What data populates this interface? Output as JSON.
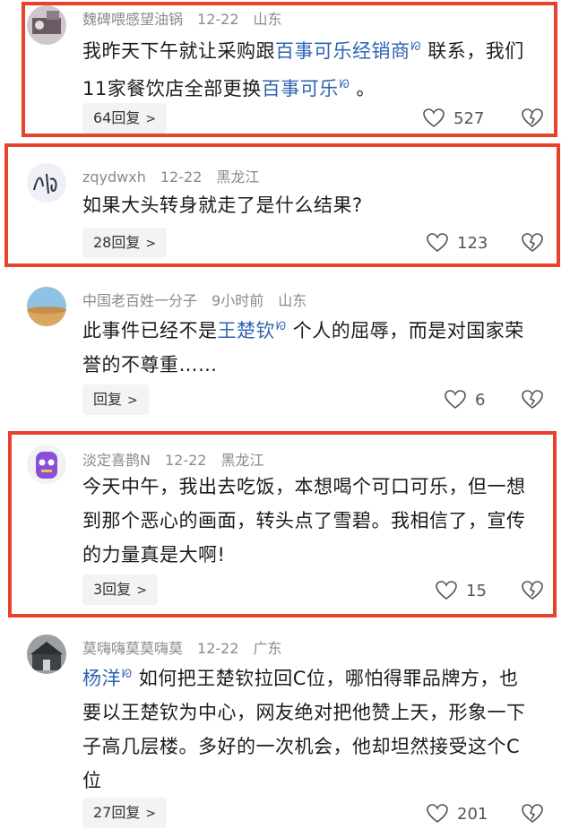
{
  "comments": [
    {
      "user": "魏碑喂感望油锅",
      "date": "12-22",
      "location": "山东",
      "text": [
        {
          "t": "我昨天下午就让采购跟"
        },
        {
          "t": "百事可乐经销商",
          "link": true
        },
        {
          "t": " 联系，我们11家餐饮店全部更换"
        },
        {
          "t": "百事可乐",
          "link": true
        },
        {
          "t": " 。"
        }
      ],
      "reply_label": "64回复",
      "likes": "527",
      "highlighted": true
    },
    {
      "user": "zqydwxh",
      "date": "12-22",
      "location": "黑龙江",
      "text": [
        {
          "t": "如果大头转身就走了是什么结果?"
        }
      ],
      "reply_label": "28回复",
      "likes": "123",
      "highlighted": true
    },
    {
      "user": "中国老百姓一分子",
      "date": "9小时前",
      "location": "山东",
      "text": [
        {
          "t": "此事件已经不是"
        },
        {
          "t": "王楚钦",
          "link": true
        },
        {
          "t": " 个人的屈辱，而是对国家荣誉的不尊重……"
        }
      ],
      "reply_label": "回复",
      "likes": "6",
      "highlighted": false
    },
    {
      "user": "淡定喜鹊N",
      "date": "12-22",
      "location": "黑龙江",
      "text": [
        {
          "t": "今天中午，我出去吃饭，本想喝个可口可乐，但一想到那个恶心的画面，转头点了雪碧。我相信了，宣传的力量真是大啊!"
        }
      ],
      "reply_label": "3回复",
      "likes": "15",
      "highlighted": true
    },
    {
      "user": "莫嗨嗨莫莫嗨莫",
      "date": "12-22",
      "location": "广东",
      "text": [
        {
          "t": "杨洋",
          "link": true
        },
        {
          "t": " 如何把王楚钦拉回C位，哪怕得罪品牌方，也要以王楚钦为中心，网友绝对把他赞上天，形象一下子高几层楼。多好的一次机会，他却坦然接受这个C位"
        }
      ],
      "reply_label": "27回复",
      "likes": "201",
      "highlighted": false
    }
  ],
  "colors": {
    "highlight": "#e8412c",
    "link": "#2f64b3"
  },
  "icons": {
    "search_marker": "search-icon",
    "like": "heart-icon",
    "dislike": "broken-heart-icon"
  }
}
